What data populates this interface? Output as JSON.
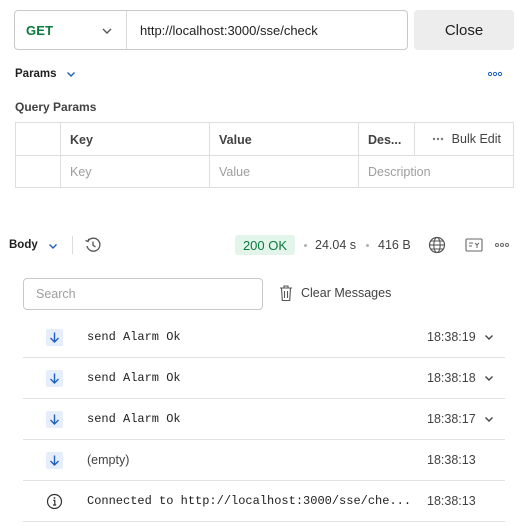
{
  "request": {
    "method": "GET",
    "method_icon": "chevron-down-icon",
    "url": "http://localhost:3000/sse/check",
    "close_label": "Close"
  },
  "params": {
    "tab_label": "Params",
    "more_icon": "more-horizontal-icon",
    "section_title": "Query Params",
    "headers": {
      "key": "Key",
      "value": "Value",
      "description": "Des...",
      "bulk_edit": "Bulk Edit"
    },
    "placeholders": {
      "key": "Key",
      "value": "Value",
      "description": "Description"
    }
  },
  "response": {
    "body_label": "Body",
    "status": "200 OK",
    "time": "24.04 s",
    "size": "416 B",
    "status_color": "#0b7a3e"
  },
  "messages": {
    "search_placeholder": "Search",
    "clear_label": "Clear Messages",
    "items": [
      {
        "icon": "arrow-down-icon",
        "text": "send Alarm Ok",
        "time": "18:38:19",
        "expandable": true,
        "mono": true
      },
      {
        "icon": "arrow-down-icon",
        "text": "send Alarm Ok",
        "time": "18:38:18",
        "expandable": true,
        "mono": true
      },
      {
        "icon": "arrow-down-icon",
        "text": "send Alarm Ok",
        "time": "18:38:17",
        "expandable": true,
        "mono": true
      },
      {
        "icon": "arrow-down-icon",
        "text": "(empty)",
        "time": "18:38:13",
        "expandable": false,
        "mono": false
      },
      {
        "icon": "info-icon",
        "text": "Connected to http://localhost:3000/sse/che...",
        "time": "18:38:13",
        "expandable": false,
        "mono": true
      }
    ]
  }
}
